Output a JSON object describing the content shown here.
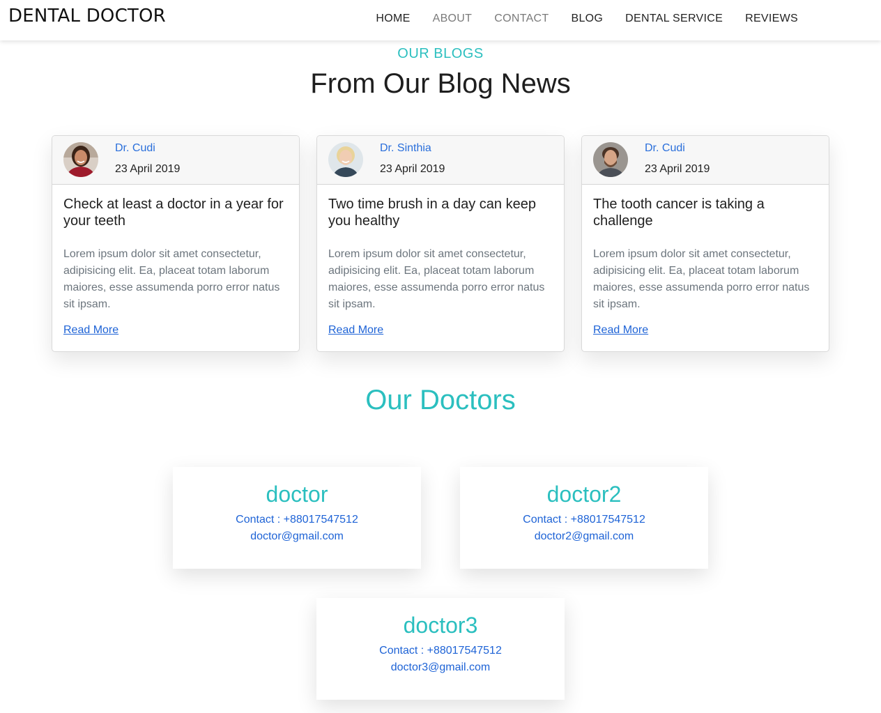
{
  "brand": "DENTAL DOCTOR",
  "nav": [
    {
      "label": "HOME"
    },
    {
      "label": "ABOUT"
    },
    {
      "label": "CONTACT"
    },
    {
      "label": "BLOG"
    },
    {
      "label": "DENTAL SERVICE"
    },
    {
      "label": "REVIEWS"
    }
  ],
  "blogs": {
    "kicker": "OUR BLOGS",
    "title": "From Our Blog News",
    "posts": [
      {
        "author": "Dr. Cudi",
        "date": "23 April 2019",
        "title": "Check at least a doctor in a year for your teeth",
        "excerpt": "Lorem ipsum dolor sit amet consectetur, adipisicing elit. Ea, placeat totam laborum maiores, esse assumenda porro error natus sit ipsam.",
        "link": "Read More",
        "avatar": "woman-red-sweater-avatar"
      },
      {
        "author": "Dr. Sinthia",
        "date": "23 April 2019",
        "title": "Two time brush in a day can keep you healthy",
        "excerpt": "Lorem ipsum dolor sit amet consectetur, adipisicing elit. Ea, placeat totam laborum maiores, esse assumenda porro error natus sit ipsam.",
        "link": "Read More",
        "avatar": "blonde-woman-avatar"
      },
      {
        "author": "Dr. Cudi",
        "date": "23 April 2019",
        "title": "The tooth cancer is taking a challenge",
        "excerpt": "Lorem ipsum dolor sit amet consectetur, adipisicing elit. Ea, placeat totam laborum maiores, esse assumenda porro error natus sit ipsam.",
        "link": "Read More",
        "avatar": "bearded-man-avatar"
      }
    ]
  },
  "doctors": {
    "title": "Our Doctors",
    "list": [
      {
        "name": "doctor",
        "contact": "Contact : +88017547512",
        "email": "doctor@gmail.com"
      },
      {
        "name": "doctor2",
        "contact": "Contact : +88017547512",
        "email": "doctor2@gmail.com"
      },
      {
        "name": "doctor3",
        "contact": "Contact : +88017547512",
        "email": "doctor3@gmail.com"
      }
    ]
  },
  "colors": {
    "accent": "#2bbfbf",
    "link": "#1e63d6",
    "author": "#2a6fdb"
  }
}
